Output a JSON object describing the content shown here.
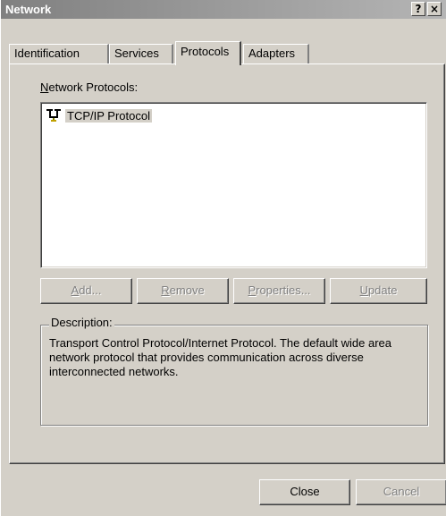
{
  "window": {
    "title": "Network",
    "help_button": "?",
    "close_button": "×"
  },
  "tabs": [
    {
      "label": "Identification",
      "active": false
    },
    {
      "label": "Services",
      "active": false
    },
    {
      "label": "Protocols",
      "active": true
    },
    {
      "label": "Adapters",
      "active": false
    }
  ],
  "protocols": {
    "label_mnemonic": "N",
    "label_rest": "etwork Protocols:",
    "items": [
      {
        "label": "TCP/IP Protocol",
        "icon": "network-protocol-icon",
        "selected": true
      }
    ]
  },
  "actions": {
    "add": {
      "mnemonic": "A",
      "rest": "dd...",
      "enabled": false
    },
    "remove": {
      "mnemonic": "R",
      "rest": "emove",
      "enabled": false
    },
    "properties": {
      "mnemonic": "P",
      "rest": "roperties...",
      "enabled": false
    },
    "update": {
      "mnemonic": "U",
      "rest": "pdate",
      "enabled": false
    }
  },
  "description": {
    "label": "Description:",
    "text": "Transport Control Protocol/Internet Protocol. The default wide area network protocol that provides communication across diverse interconnected networks."
  },
  "footer": {
    "close": "Close",
    "cancel": "Cancel"
  }
}
